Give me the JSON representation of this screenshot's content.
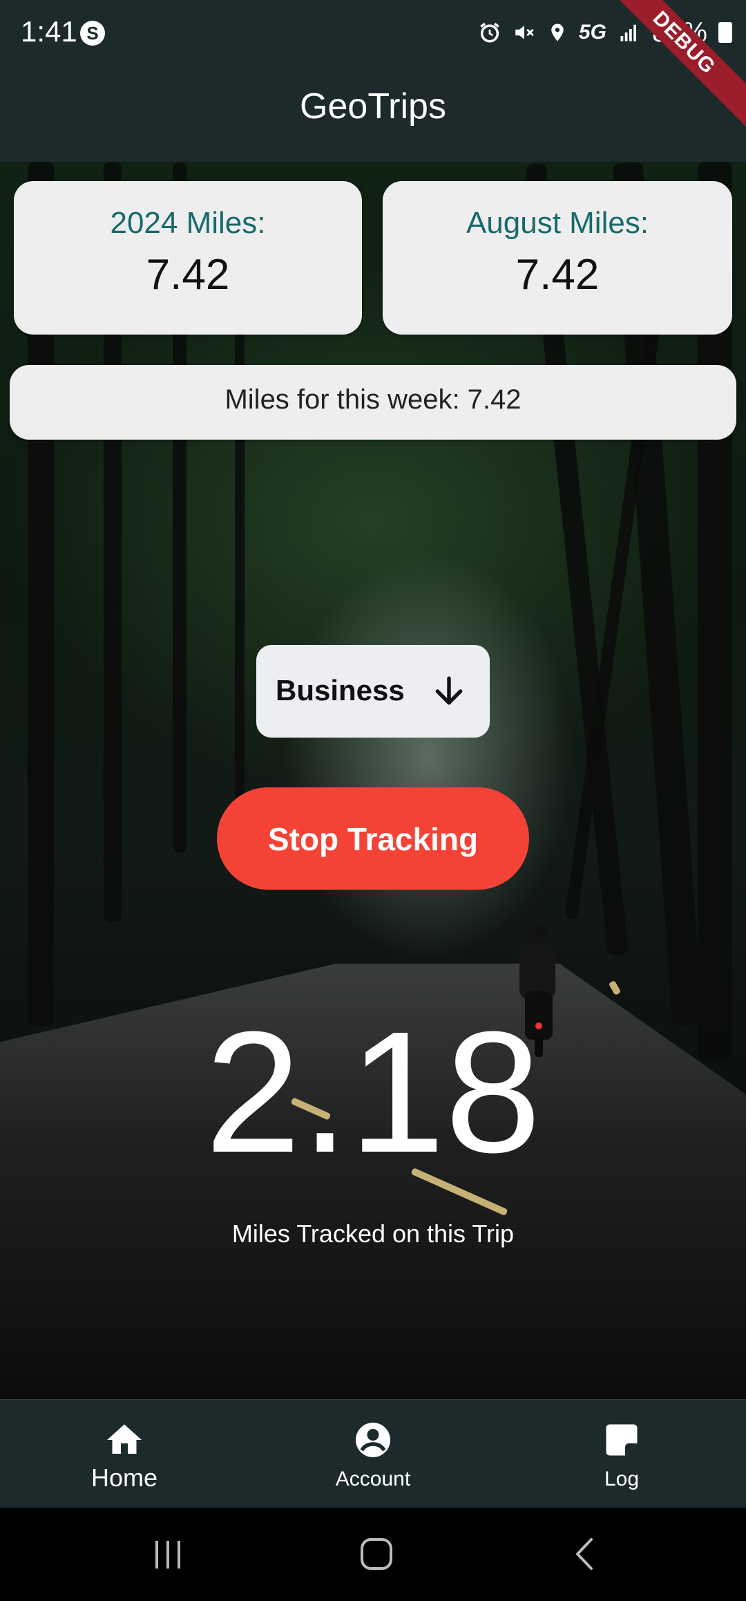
{
  "status_bar": {
    "time": "1:41",
    "app_icon": "S",
    "network": "5G",
    "battery": "85%"
  },
  "debug_banner": "DEBUG",
  "app_bar": {
    "title": "GeoTrips"
  },
  "stats": {
    "year": {
      "label": "2024 Miles:",
      "value": "7.42"
    },
    "month": {
      "label": "August Miles:",
      "value": "7.42"
    },
    "week": {
      "text": "Miles for this week: 7.42"
    }
  },
  "trip_type": {
    "selected": "Business",
    "icon": "arrow-down-icon"
  },
  "stop_button": {
    "label": "Stop Tracking",
    "color": "#f44336"
  },
  "current_trip": {
    "miles": "2.18",
    "label": "Miles Tracked on this Trip"
  },
  "bottom_nav": {
    "items": [
      {
        "label": "Home",
        "icon": "home-icon",
        "active": true
      },
      {
        "label": "Account",
        "icon": "account-circle-icon",
        "active": false
      },
      {
        "label": "Log",
        "icon": "note-icon",
        "active": false
      }
    ]
  },
  "colors": {
    "app_bar": "#1c2a2b",
    "card_label": "#176a6c",
    "card_bg": "#eeeeee"
  }
}
